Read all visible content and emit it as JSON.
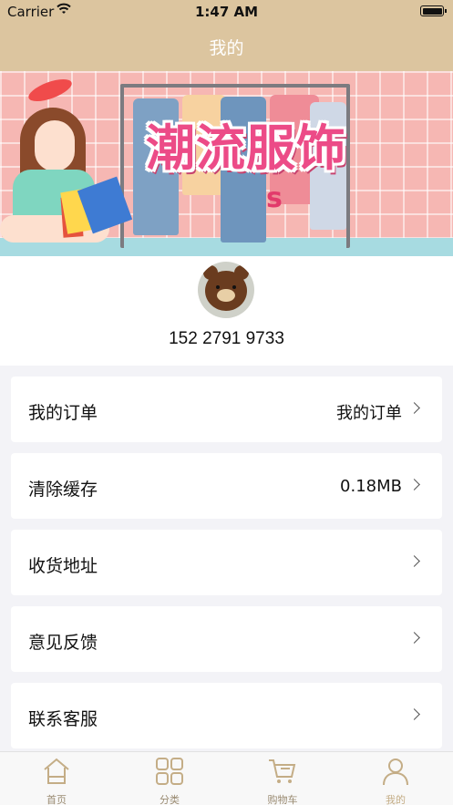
{
  "status_bar": {
    "carrier": "Carrier",
    "time": "1:47 AM"
  },
  "nav": {
    "title": "我的"
  },
  "banner": {
    "title": "潮流服饰",
    "sub": "s"
  },
  "profile": {
    "phone": "152 2791 9733"
  },
  "menu": [
    {
      "label": "我的订单",
      "value": "我的订单"
    },
    {
      "label": "清除缓存",
      "value": "0.18MB"
    },
    {
      "label": "收货地址",
      "value": ""
    },
    {
      "label": "意见反馈",
      "value": ""
    },
    {
      "label": "联系客服",
      "value": ""
    }
  ],
  "tabs": [
    {
      "label": "首页",
      "icon": "home-icon"
    },
    {
      "label": "分类",
      "icon": "grid-icon"
    },
    {
      "label": "购物车",
      "icon": "cart-icon"
    },
    {
      "label": "我的",
      "icon": "person-icon",
      "active": true
    }
  ],
  "colors": {
    "nav_bg": "#dcc59f",
    "tab_icon": "#c4ad86",
    "page_bg": "#f3f3f7"
  }
}
